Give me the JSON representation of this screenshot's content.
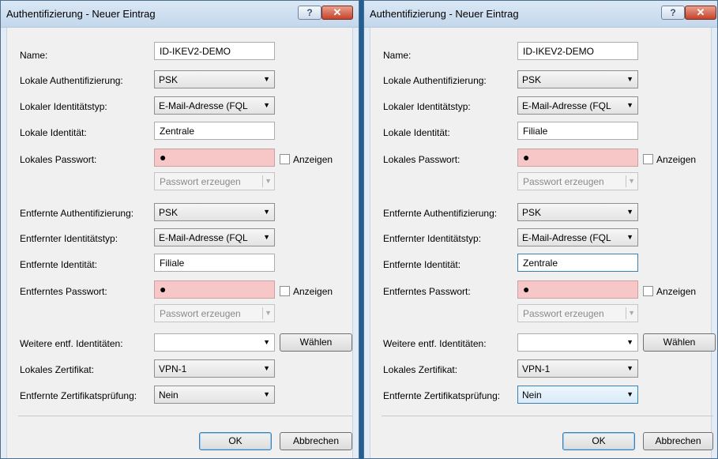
{
  "dialogs": [
    {
      "title": "Authentifizierung - Neuer Eintrag",
      "help": "?",
      "close": "✕",
      "labels": {
        "name": "Name:",
        "local_auth": "Lokale Authentifizierung:",
        "local_idtype": "Lokaler Identitätstyp:",
        "local_id": "Lokale Identität:",
        "local_pw": "Lokales Passwort:",
        "remote_auth": "Entfernte Authentifizierung:",
        "remote_idtype": "Entfernter Identitätstyp:",
        "remote_id": "Entfernte Identität:",
        "remote_pw": "Entferntes Passwort:",
        "more_ids": "Weitere entf. Identitäten:",
        "local_cert": "Lokales Zertifikat:",
        "remote_cert_check": "Entfernte Zertifikatsprüfung:"
      },
      "values": {
        "name": "ID-IKEV2-DEMO",
        "local_auth": "PSK",
        "local_idtype": "E-Mail-Adresse (FQL",
        "local_id": "Zentrale",
        "local_pw": "●",
        "remote_auth": "PSK",
        "remote_idtype": "E-Mail-Adresse (FQL",
        "remote_id": "Filiale",
        "remote_pw": "●",
        "more_ids": "",
        "local_cert": "VPN-1",
        "remote_cert_check": "Nein"
      },
      "show_label": "Anzeigen",
      "gen_pw": "Passwort erzeugen",
      "choose": "Wählen",
      "ok": "OK",
      "cancel": "Abbrechen"
    },
    {
      "title": "Authentifizierung - Neuer Eintrag",
      "help": "?",
      "close": "✕",
      "labels": {
        "name": "Name:",
        "local_auth": "Lokale Authentifizierung:",
        "local_idtype": "Lokaler Identitätstyp:",
        "local_id": "Lokale Identität:",
        "local_pw": "Lokales Passwort:",
        "remote_auth": "Entfernte Authentifizierung:",
        "remote_idtype": "Entfernter Identitätstyp:",
        "remote_id": "Entfernte Identität:",
        "remote_pw": "Entferntes Passwort:",
        "more_ids": "Weitere entf. Identitäten:",
        "local_cert": "Lokales Zertifikat:",
        "remote_cert_check": "Entfernte Zertifikatsprüfung:"
      },
      "values": {
        "name": "ID-IKEV2-DEMO",
        "local_auth": "PSK",
        "local_idtype": "E-Mail-Adresse (FQL",
        "local_id": "Filiale",
        "local_pw": "●",
        "remote_auth": "PSK",
        "remote_idtype": "E-Mail-Adresse (FQL",
        "remote_id": "Zentrale",
        "remote_pw": "●",
        "more_ids": "",
        "local_cert": "VPN-1",
        "remote_cert_check": "Nein"
      },
      "show_label": "Anzeigen",
      "gen_pw": "Passwort erzeugen",
      "choose": "Wählen",
      "ok": "OK",
      "cancel": "Abbrechen"
    }
  ],
  "icons": {
    "dropdown": "▼"
  }
}
